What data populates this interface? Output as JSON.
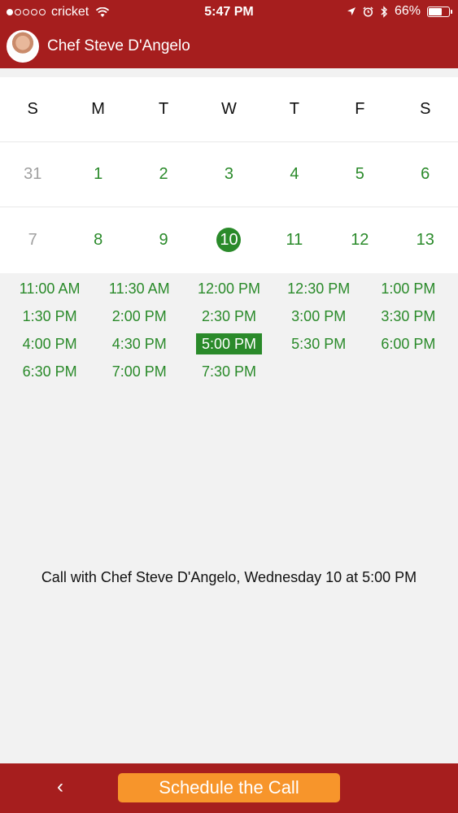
{
  "status_bar": {
    "carrier": "cricket",
    "time": "5:47 PM",
    "battery": "66%",
    "battery_level": 0.66,
    "signal_bars_filled": 1,
    "signal_bars_total": 5
  },
  "header": {
    "chef_name": "Chef Steve D'Angelo"
  },
  "calendar": {
    "weekdays": [
      "S",
      "M",
      "T",
      "W",
      "T",
      "F",
      "S"
    ],
    "weeks": [
      [
        "31",
        "1",
        "2",
        "3",
        "4",
        "5",
        "6"
      ],
      [
        "7",
        "8",
        "9",
        "10",
        "11",
        "12",
        "13"
      ]
    ],
    "muted_days": [
      "31",
      "7"
    ],
    "selected_day": "10"
  },
  "time_slots": [
    "11:00 AM",
    "11:30 AM",
    "12:00 PM",
    "12:30 PM",
    "1:00 PM",
    "1:30 PM",
    "2:00 PM",
    "2:30 PM",
    "3:00 PM",
    "3:30 PM",
    "4:00 PM",
    "4:30 PM",
    "5:00 PM",
    "5:30 PM",
    "6:00 PM",
    "6:30 PM",
    "7:00 PM",
    "7:30 PM"
  ],
  "selected_slot": "5:00 PM",
  "summary": "Call with Chef Steve D'Angelo, Wednesday 10 at 5:00 PM",
  "footer": {
    "back_icon": "‹",
    "schedule_label": "Schedule the Call"
  },
  "colors": {
    "brand_red": "#a61e1e",
    "accent_green": "#2a8a2a",
    "button_orange": "#f7952b"
  }
}
